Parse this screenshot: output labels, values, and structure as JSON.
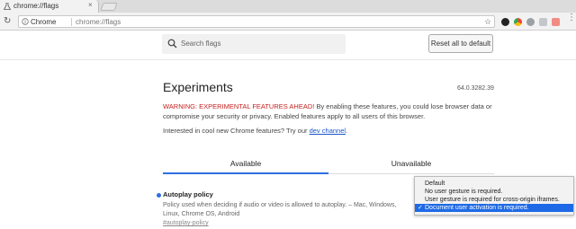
{
  "browser": {
    "tab_title": "chrome://flags",
    "tab_close": "×",
    "omnibox_site": "Chrome",
    "omnibox_url": "chrome://flags",
    "star_glyph": "☆",
    "back_glyph": "←",
    "reload_glyph": "↻",
    "menu_glyph": "⋮"
  },
  "header": {
    "search_placeholder": "Search flags",
    "reset_button": "Reset all to default"
  },
  "experiments": {
    "title": "Experiments",
    "version": "64.0.3282.39",
    "warning_prefix": "WARNING: EXPERIMENTAL FEATURES AHEAD!",
    "warning_body": " By enabling these features, you could lose browser data or compromise your security or privacy. Enabled features apply to all users of this browser.",
    "interest_text": "Interested in cool new Chrome features? Try our ",
    "interest_link": "dev channel",
    "interest_end": "."
  },
  "tabs": {
    "available": "Available",
    "unavailable": "Unavailable"
  },
  "flag": {
    "name": "Autoplay policy",
    "description": "Policy used when deciding if audio or video is allowed to autoplay. – Mac, Windows, Linux, Chrome OS, Android",
    "hash": "#autoplay-policy"
  },
  "dropdown": {
    "options": [
      "Default",
      "No user gesture is required.",
      "User gesture is required for cross-origin iframes.",
      "Document user activation is required."
    ],
    "selected_index": 3,
    "check_glyph": "✓"
  },
  "colors": {
    "accent": "#2f6fe0",
    "warning": "#c5221f",
    "selection": "#1e6ae6"
  }
}
